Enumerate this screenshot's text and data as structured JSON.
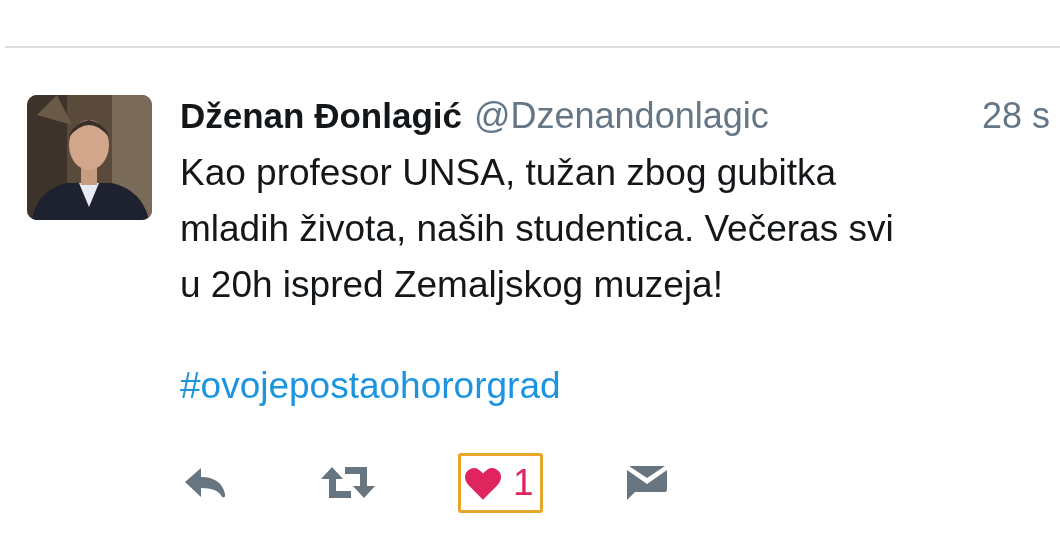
{
  "tweet": {
    "name": "Dženan Đonlagić",
    "handle": "@Dzenandonlagic",
    "time": "28 s",
    "text": "Kao profesor UNSA, tužan zbog gubitka\nmladih života, naših studentica. Večeras svi\nu 20h ispred Zemaljskog muzeja!",
    "hashtag": "#ovojepostaohororgrad",
    "like": {
      "liked": true,
      "count": "1",
      "highlighted": true
    }
  }
}
